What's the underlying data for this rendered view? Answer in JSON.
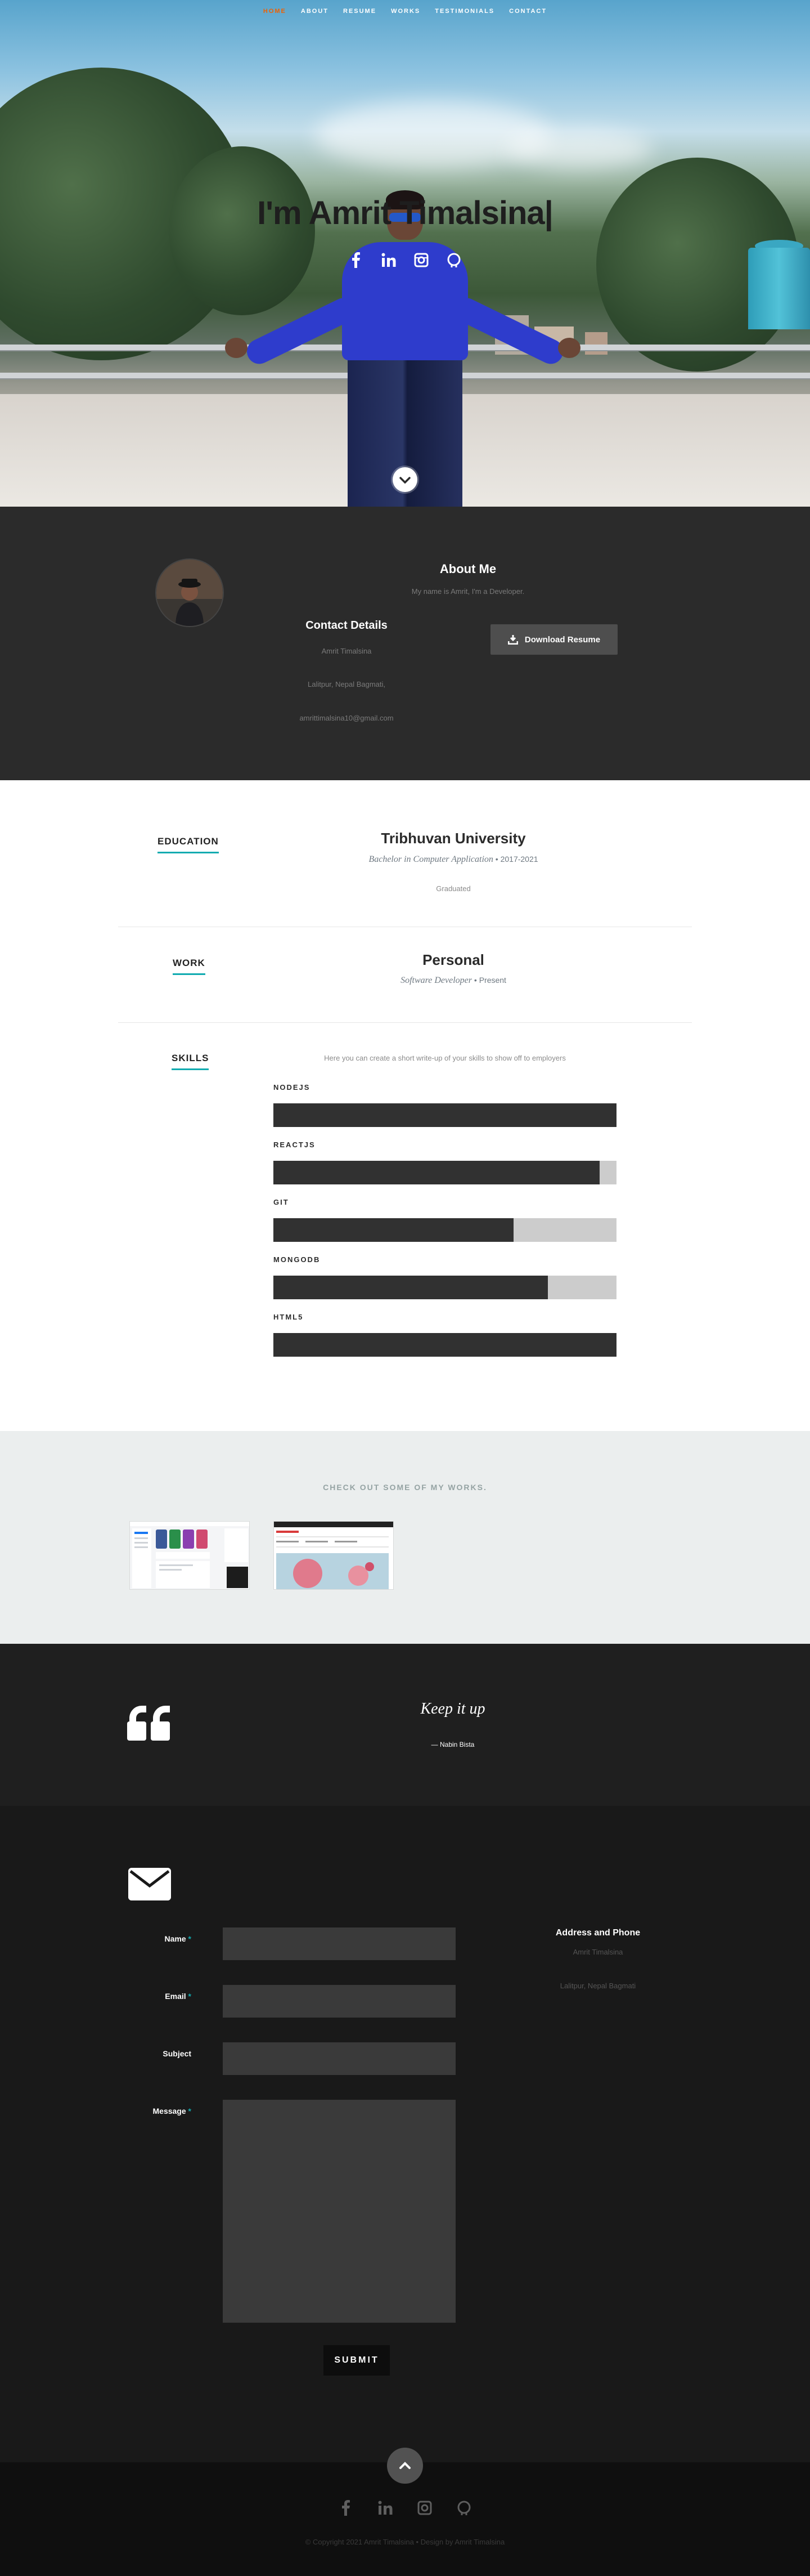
{
  "nav": {
    "items": [
      {
        "label": "HOME",
        "active": true
      },
      {
        "label": "ABOUT",
        "active": false
      },
      {
        "label": "RESUME",
        "active": false
      },
      {
        "label": "WORKS",
        "active": false
      },
      {
        "label": "TESTIMONIALS",
        "active": false
      },
      {
        "label": "CONTACT",
        "active": false
      }
    ],
    "active_color": "#f06000"
  },
  "hero": {
    "title": "I'm Amrit Timalsina|",
    "social": [
      "facebook-icon",
      "linkedin-icon",
      "instagram-icon",
      "github-icon"
    ]
  },
  "about": {
    "title": "About Me",
    "description": "My name is Amrit, I'm a Developer.",
    "contact_title": "Contact Details",
    "contact_lines": [
      "Amrit Timalsina",
      "Lalitpur, Nepal Bagmati,",
      "amrittimalsina10@gmail.com"
    ],
    "download_label": "Download Resume"
  },
  "resume": {
    "education": {
      "label": "EDUCATION",
      "school": "Tribhuvan University",
      "degree": "Bachelor in Computer Application",
      "years": "2017-2021",
      "note": "Graduated"
    },
    "work": {
      "label": "WORK",
      "company": "Personal",
      "role": "Software Developer",
      "period": "Present"
    },
    "skills": {
      "label": "SKILLS",
      "intro": "Here you can create a short write-up of your skills to show off to employers",
      "items": [
        {
          "name": "NODEJS",
          "level": 1.0
        },
        {
          "name": "REACTJS",
          "level": 0.95
        },
        {
          "name": "GIT",
          "level": 0.7
        },
        {
          "name": "MONGODB",
          "level": 0.8
        },
        {
          "name": "HTML5",
          "level": 1.0
        }
      ]
    }
  },
  "works": {
    "title": "CHECK OUT SOME OF MY WORKS."
  },
  "testimonials": {
    "quote": "Keep it up",
    "author": "— Nabin Bista"
  },
  "contact": {
    "fields": {
      "name_label": "Name",
      "email_label": "Email",
      "subject_label": "Subject",
      "message_label": "Message",
      "required_mark": "*"
    },
    "submit_label": "SUBMIT",
    "address_title": "Address and Phone",
    "address_lines": [
      "Amrit Timalsina",
      "Lalitpur, Nepal Bagmati"
    ]
  },
  "footer": {
    "social": [
      "facebook-icon",
      "linkedin-icon",
      "instagram-icon",
      "github-icon"
    ],
    "copyright": "© Copyright 2021 Amrit Timalsina   •   Design by Amrit Timalsina"
  },
  "colors": {
    "accent": "#11abb0",
    "dark_section": "#2b2b2b",
    "works_bg": "#ebeeee"
  }
}
